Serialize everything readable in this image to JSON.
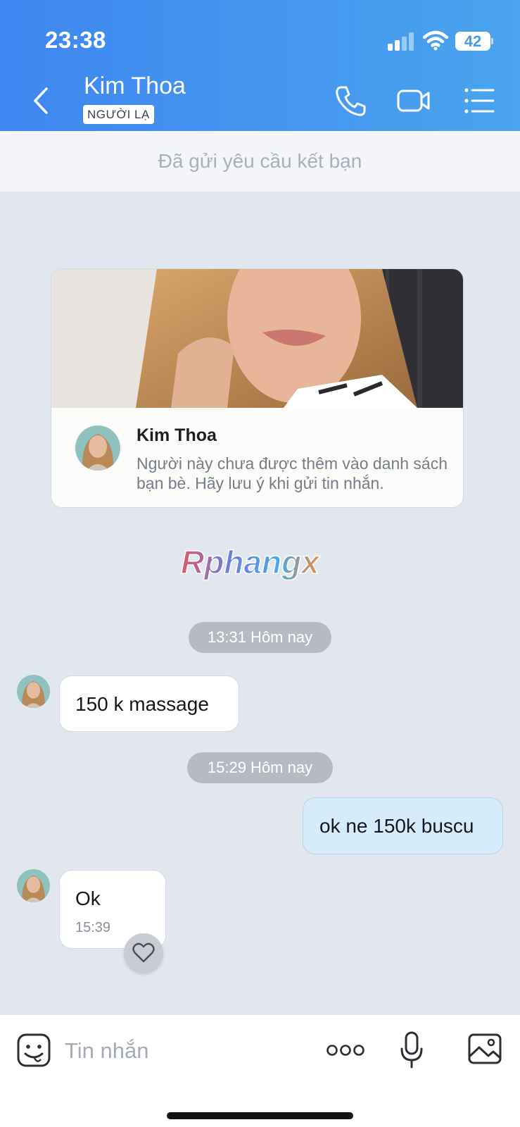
{
  "status_bar": {
    "time": "23:38",
    "battery": "42"
  },
  "header": {
    "contact_name": "Kim Thoa",
    "badge": "NGƯỜI LẠ",
    "icons": [
      "back-chevron-icon",
      "phone-icon",
      "video-call-icon",
      "menu-list-icon"
    ]
  },
  "friend_request": {
    "text": "Đã gửi yêu cầu kết bạn"
  },
  "profile_card": {
    "name": "Kim Thoa",
    "note": "Người này chưa được thêm vào danh sách bạn bè. Hãy lưu ý khi gửi tin nhắn."
  },
  "watermark": "Rphangx",
  "messages": [
    {
      "type": "time",
      "text": "13:31 Hôm nay"
    },
    {
      "type": "incoming",
      "text": "150 k massage"
    },
    {
      "type": "time",
      "text": "15:29 Hôm nay"
    },
    {
      "type": "outgoing",
      "text": "ok ne 150k buscu"
    },
    {
      "type": "incoming",
      "text": "Ok",
      "time": "15:39"
    }
  ],
  "input_bar": {
    "placeholder": "Tin nhắn",
    "icons": [
      "emoji-sticker-icon",
      "more-options-icon",
      "microphone-icon",
      "image-icon"
    ]
  },
  "colors": {
    "header_start": "#3f86f0",
    "header_end": "#4aa4ee",
    "chat_bg": "#e2e7ef",
    "outgoing_bubble": "#d6ecfb"
  }
}
